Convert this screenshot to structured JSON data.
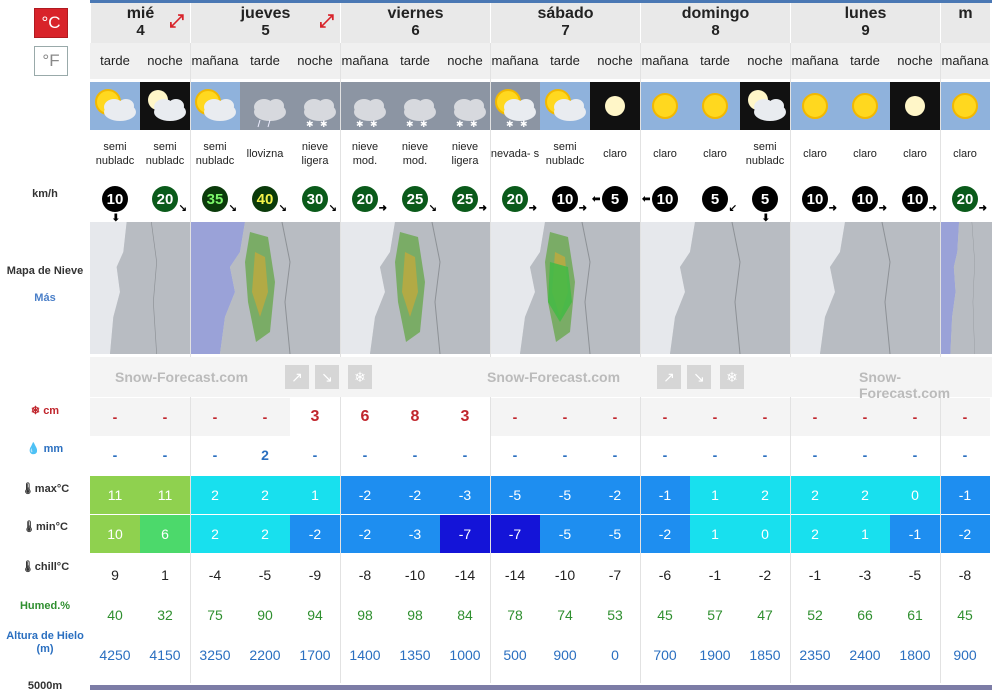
{
  "units": {
    "celsius": "°C",
    "fahrenheit": "°F"
  },
  "labels": {
    "wind": "km/h",
    "snow_map": "Mapa de Nieve",
    "more": "Más",
    "snow": "cm",
    "rain": "mm",
    "max": "max°C",
    "min": "min°C",
    "chill": "chill°C",
    "humidity": "Humed.%",
    "freezing": "Altura de Hielo (m)",
    "altitude": "5000m"
  },
  "banner": "Snow-Forecast.com",
  "days": [
    {
      "name": "mié",
      "num": "4"
    },
    {
      "name": "jueves",
      "num": "5"
    },
    {
      "name": "viernes",
      "num": "6"
    },
    {
      "name": "sábado",
      "num": "7"
    },
    {
      "name": "domingo",
      "num": "8"
    },
    {
      "name": "lunes",
      "num": "9"
    },
    {
      "name": "m",
      "num": ""
    }
  ],
  "periods": [
    {
      "tod": "tarde",
      "icon": "partly-cloudy-sun-icon",
      "desc": "semi nubladc",
      "wind": "10",
      "wdir": "down",
      "snow": "-",
      "rain": "-",
      "max": "11",
      "min": "10",
      "chill": "9",
      "hum": "40",
      "fl": "4250",
      "maxc": "#8fd14f",
      "minc": "#8fd14f"
    },
    {
      "tod": "noche",
      "icon": "partly-cloudy-moon-icon",
      "desc": "semi nubladc",
      "wind": "20",
      "wdir": "downright",
      "snow": "-",
      "rain": "-",
      "max": "11",
      "min": "6",
      "chill": "1",
      "hum": "32",
      "fl": "4150",
      "maxc": "#8fd14f",
      "minc": "#4cd96b"
    },
    {
      "tod": "mañana",
      "icon": "partly-cloudy-sun-icon",
      "desc": "semi nubladc",
      "wind": "35",
      "wdir": "downright",
      "snow": "-",
      "rain": "-",
      "max": "2",
      "min": "2",
      "chill": "-4",
      "hum": "75",
      "fl": "3250",
      "maxc": "#18e0ee",
      "minc": "#18e0ee"
    },
    {
      "tod": "tarde",
      "icon": "drizzle-icon",
      "desc": "llovizna",
      "wind": "40",
      "wdir": "downright",
      "snow": "-",
      "rain": "2",
      "max": "2",
      "min": "2",
      "chill": "-5",
      "hum": "90",
      "fl": "2200",
      "maxc": "#18e0ee",
      "minc": "#18e0ee"
    },
    {
      "tod": "noche",
      "icon": "light-snow-icon",
      "desc": "nieve ligera",
      "wind": "30",
      "wdir": "downright",
      "snow": "3",
      "rain": "-",
      "max": "1",
      "min": "-2",
      "chill": "-9",
      "hum": "94",
      "fl": "1700",
      "maxc": "#18e0ee",
      "minc": "#1e8ef0"
    },
    {
      "tod": "mañana",
      "icon": "snow-icon",
      "desc": "nieve mod.",
      "wind": "20",
      "wdir": "right",
      "snow": "6",
      "rain": "-",
      "max": "-2",
      "min": "-2",
      "chill": "-8",
      "hum": "98",
      "fl": "1400",
      "maxc": "#1e8ef0",
      "minc": "#1e8ef0"
    },
    {
      "tod": "tarde",
      "icon": "snow-icon",
      "desc": "nieve mod.",
      "wind": "25",
      "wdir": "downright",
      "snow": "8",
      "rain": "-",
      "max": "-2",
      "min": "-3",
      "chill": "-10",
      "hum": "98",
      "fl": "1350",
      "maxc": "#1e8ef0",
      "minc": "#1e8ef0"
    },
    {
      "tod": "noche",
      "icon": "light-snow-icon",
      "desc": "nieve ligera",
      "wind": "25",
      "wdir": "right",
      "snow": "3",
      "rain": "-",
      "max": "-3",
      "min": "-7",
      "chill": "-14",
      "hum": "84",
      "fl": "1000",
      "maxc": "#1e8ef0",
      "minc": "#1414d8"
    },
    {
      "tod": "mañana",
      "icon": "snow-shower-icon",
      "desc": "nevada- s",
      "wind": "20",
      "wdir": "right",
      "snow": "-",
      "rain": "-",
      "max": "-5",
      "min": "-7",
      "chill": "-14",
      "hum": "78",
      "fl": "500",
      "maxc": "#1e8ef0",
      "minc": "#1414d8"
    },
    {
      "tod": "tarde",
      "icon": "partly-cloudy-sun-icon",
      "desc": "semi nubladc",
      "wind": "10",
      "wdir": "right",
      "snow": "-",
      "rain": "-",
      "max": "-5",
      "min": "-5",
      "chill": "-10",
      "hum": "74",
      "fl": "900",
      "maxc": "#1e8ef0",
      "minc": "#1e8ef0"
    },
    {
      "tod": "noche",
      "icon": "clear-moon-icon",
      "desc": "claro",
      "wind": "5",
      "wdir": "left",
      "snow": "-",
      "rain": "-",
      "max": "-2",
      "min": "-5",
      "chill": "-7",
      "hum": "53",
      "fl": "0",
      "maxc": "#1e8ef0",
      "minc": "#1e8ef0"
    },
    {
      "tod": "mañana",
      "icon": "clear-sun-icon",
      "desc": "claro",
      "wind": "10",
      "wdir": "left",
      "snow": "-",
      "rain": "-",
      "max": "-1",
      "min": "-2",
      "chill": "-6",
      "hum": "45",
      "fl": "700",
      "maxc": "#1e8ef0",
      "minc": "#1e8ef0"
    },
    {
      "tod": "tarde",
      "icon": "clear-sun-icon",
      "desc": "claro",
      "wind": "5",
      "wdir": "downleft",
      "snow": "-",
      "rain": "-",
      "max": "1",
      "min": "1",
      "chill": "-1",
      "hum": "57",
      "fl": "1900",
      "maxc": "#18e0ee",
      "minc": "#18e0ee"
    },
    {
      "tod": "noche",
      "icon": "partly-cloudy-moon-icon",
      "desc": "semi nubladc",
      "wind": "5",
      "wdir": "down",
      "snow": "-",
      "rain": "-",
      "max": "2",
      "min": "0",
      "chill": "-2",
      "hum": "47",
      "fl": "1850",
      "maxc": "#18e0ee",
      "minc": "#18e0ee"
    },
    {
      "tod": "mañana",
      "icon": "clear-sun-icon",
      "desc": "claro",
      "wind": "10",
      "wdir": "right",
      "snow": "-",
      "rain": "-",
      "max": "2",
      "min": "2",
      "chill": "-1",
      "hum": "52",
      "fl": "2350",
      "maxc": "#18e0ee",
      "minc": "#18e0ee"
    },
    {
      "tod": "tarde",
      "icon": "clear-sun-icon",
      "desc": "claro",
      "wind": "10",
      "wdir": "right",
      "snow": "-",
      "rain": "-",
      "max": "2",
      "min": "1",
      "chill": "-3",
      "hum": "66",
      "fl": "2400",
      "maxc": "#18e0ee",
      "minc": "#18e0ee"
    },
    {
      "tod": "noche",
      "icon": "clear-moon-icon",
      "desc": "claro",
      "wind": "10",
      "wdir": "right",
      "snow": "-",
      "rain": "-",
      "max": "0",
      "min": "-1",
      "chill": "-5",
      "hum": "61",
      "fl": "1800",
      "maxc": "#18e0ee",
      "minc": "#1e8ef0"
    },
    {
      "tod": "mañana",
      "icon": "clear-sun-icon",
      "desc": "claro",
      "wind": "20",
      "wdir": "right",
      "snow": "-",
      "rain": "-",
      "max": "-1",
      "min": "-2",
      "chill": "-8",
      "hum": "45",
      "fl": "900",
      "maxc": "#1e8ef0",
      "minc": "#1e8ef0"
    }
  ]
}
